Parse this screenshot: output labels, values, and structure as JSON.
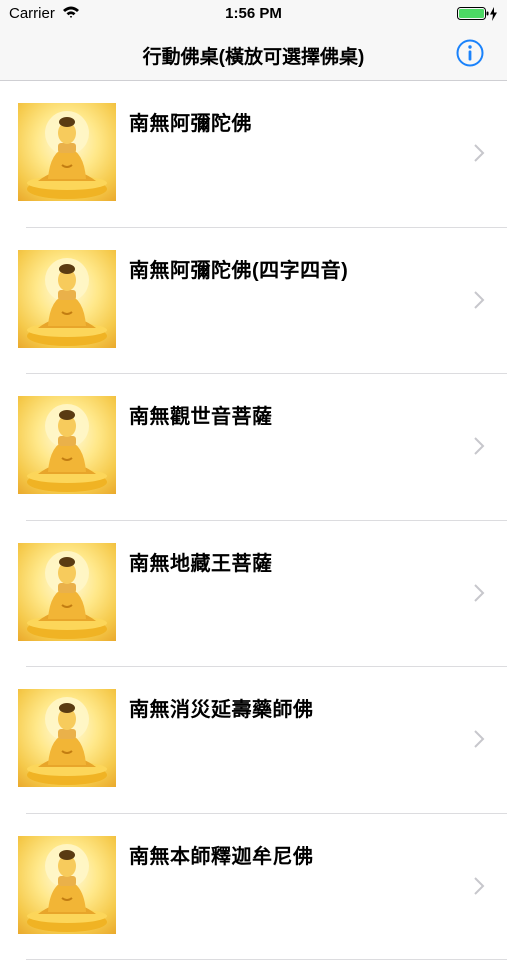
{
  "status_bar": {
    "carrier": "Carrier",
    "time": "1:56 PM",
    "wifi_icon": "wifi-icon",
    "battery_icon": "battery-charging-icon"
  },
  "nav": {
    "title": "行動佛桌(橫放可選擇佛桌)",
    "info_icon": "info-icon",
    "accent_color": "#1a82fb"
  },
  "items": [
    {
      "label": "南無阿彌陀佛"
    },
    {
      "label": "南無阿彌陀佛(四字四音)"
    },
    {
      "label": "南無觀世音菩薩"
    },
    {
      "label": "南無地藏王菩薩"
    },
    {
      "label": "南無消災延壽藥師佛"
    },
    {
      "label": "南無本師釋迦牟尼佛"
    }
  ]
}
